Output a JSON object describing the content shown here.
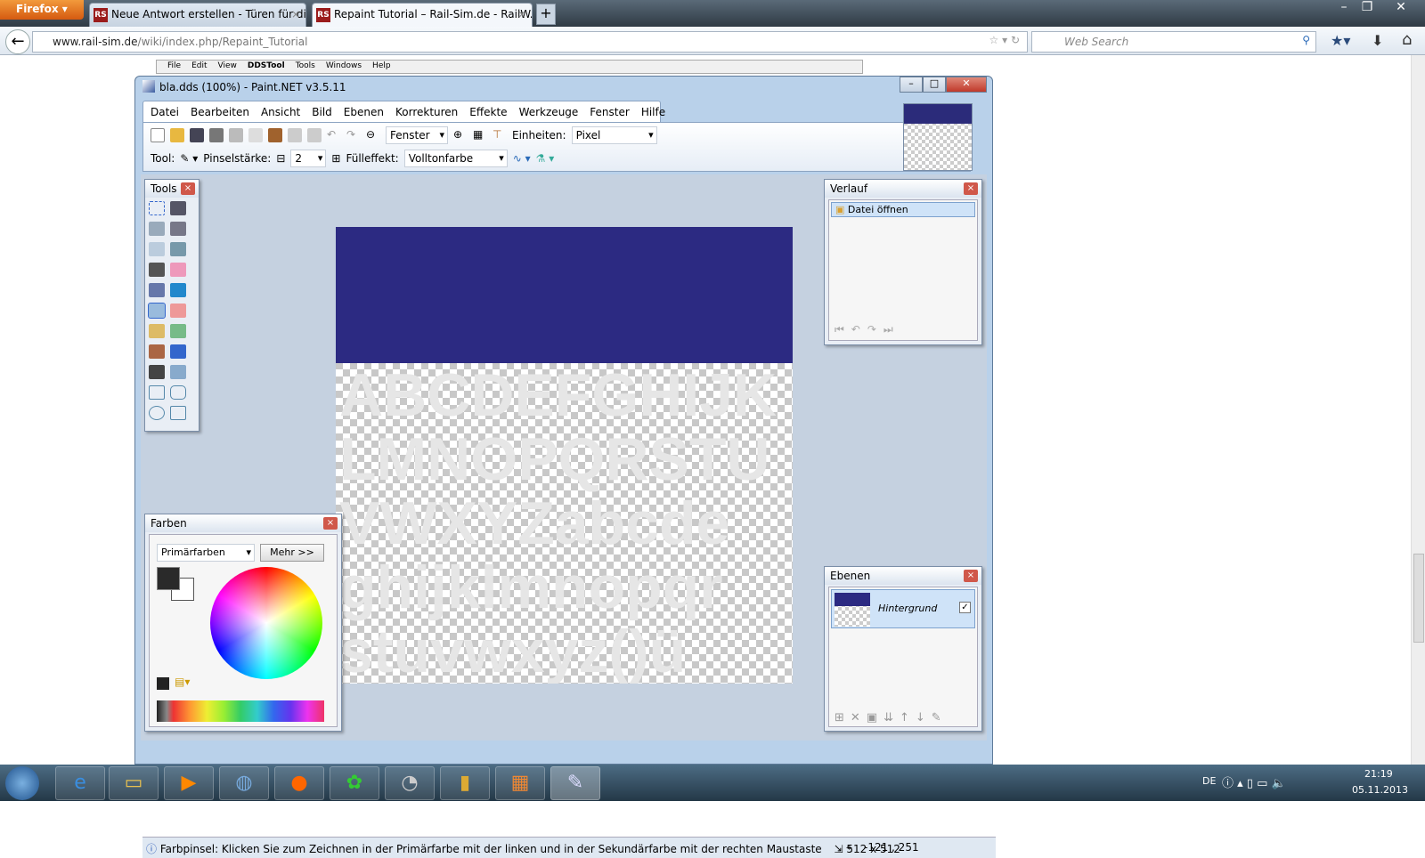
{
  "browser": {
    "menu_button": "Firefox",
    "tabs": [
      {
        "label": "Neue Antwort erstellen - Türen für di...",
        "favicon": "RS"
      },
      {
        "label": "Repaint Tutorial – Rail-Sim.de - RailW...",
        "favicon": "RS"
      }
    ],
    "url_domain": "www.rail-sim.de",
    "url_path": "/wiki/index.php/Repaint_Tutorial",
    "search_placeholder": "Web Search"
  },
  "ddstool_menu": [
    "File",
    "Edit",
    "View",
    "DDSTool",
    "Tools",
    "Windows",
    "Help"
  ],
  "paintnet": {
    "title": "bla.dds (100%) - Paint.NET v3.5.11",
    "menu": [
      "Datei",
      "Bearbeiten",
      "Ansicht",
      "Bild",
      "Ebenen",
      "Korrekturen",
      "Effekte",
      "Werkzeuge",
      "Fenster",
      "Hilfe"
    ],
    "zoom_select": "Fenster",
    "units_label": "Einheiten:",
    "units_select": "Pixel",
    "tool_label": "Tool:",
    "brush_width_label": "Pinselstärke:",
    "brush_width": "2",
    "fill_label": "Fülleffekt:",
    "fill_select": "Volltonfarbe",
    "canvas_text": [
      "ABCDEFGHIJK",
      "LMNOPQRSTU",
      "VWXYZabcde",
      "ghijklmnopqr",
      "stuvwxyz()ü"
    ],
    "canvas_color": "#2c2a82",
    "panels": {
      "tools": "Tools",
      "history": {
        "title": "Verlauf",
        "items": [
          "Datei öffnen"
        ]
      },
      "colors": {
        "title": "Farben",
        "select": "Primärfarben",
        "more": "Mehr >>"
      },
      "layers": {
        "title": "Ebenen",
        "items": [
          {
            "name": "Hintergrund",
            "visible": true
          }
        ]
      }
    },
    "status": {
      "hint": "Farbpinsel: Klicken Sie zum Zeichnen in der Primärfarbe mit der linken und in der Sekundärfarbe mit der rechten Maustaste",
      "size": "512 x 512",
      "cursor": "-121 , 251"
    }
  },
  "taskbar": {
    "lang": "DE",
    "time": "21:19",
    "date": "05.11.2013"
  }
}
